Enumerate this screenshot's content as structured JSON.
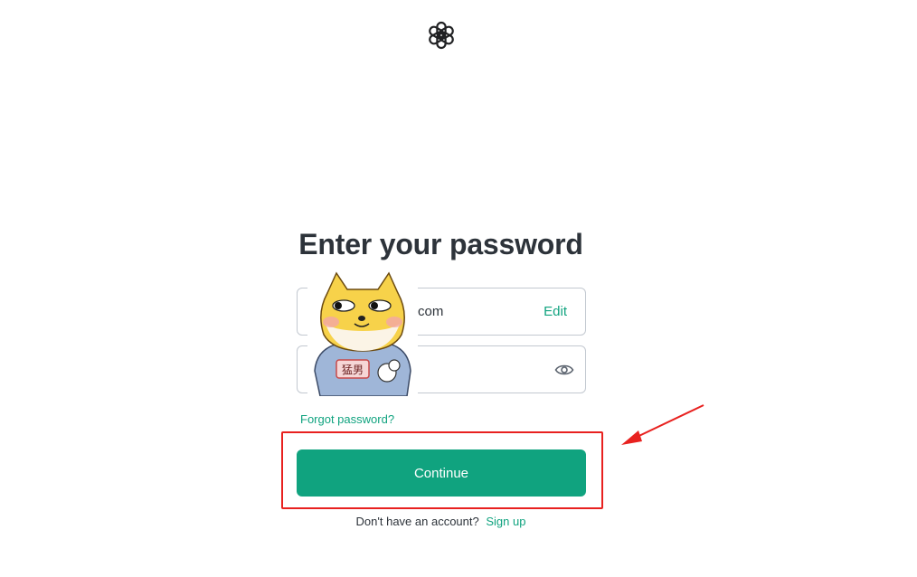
{
  "header": {
    "logo_icon": "openai-logo-icon"
  },
  "main": {
    "title": "Enter your password",
    "email": {
      "value_visible": "com",
      "edit_label": "Edit"
    },
    "password": {
      "value": "",
      "toggle_icon": "eye-icon"
    },
    "forgot_label": "Forgot password?",
    "continue_label": "Continue",
    "signup": {
      "prompt": "Don't have an account?",
      "link_label": "Sign up"
    }
  },
  "overlay": {
    "sticker_text": "猛男",
    "highlight_color": "#e8211f",
    "arrow_color": "#e8211f"
  },
  "colors": {
    "accent": "#10a37f",
    "text": "#2d333a",
    "border": "#c2c8d0"
  }
}
